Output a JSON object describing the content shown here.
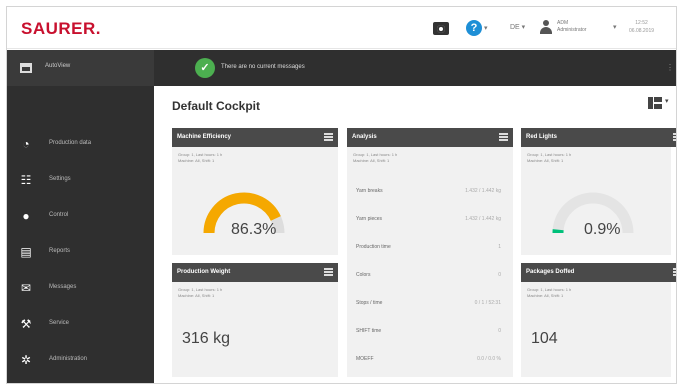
{
  "brand": {
    "logo": "SAURER.",
    "color": "#c8102e"
  },
  "topbar": {
    "camera_icon": "camera-icon",
    "help_icon_text": "?",
    "help_caret": "▾",
    "language": "DE ▾",
    "user_line1": "ADM",
    "user_line2": "Administrator",
    "user_caret": "▾",
    "time": "12:52",
    "date": "06.08.2019"
  },
  "sidebar": {
    "header_label": "AutoView",
    "items": [
      {
        "label": "Production data",
        "icon": "pie-chart-icon"
      },
      {
        "label": "Settings",
        "icon": "settings-icon"
      },
      {
        "label": "Control",
        "icon": "control-icon"
      },
      {
        "label": "Reports",
        "icon": "report-icon"
      },
      {
        "label": "Messages",
        "icon": "mail-icon"
      },
      {
        "label": "Service",
        "icon": "wrench-icon"
      },
      {
        "label": "Administration",
        "icon": "gear-icon"
      }
    ]
  },
  "notification": {
    "text": "There are no current messages",
    "check": "✓"
  },
  "main": {
    "title": "Default Cockpit",
    "layout_caret": "▾"
  },
  "cards": {
    "machine_efficiency": {
      "title": "Machine Efficiency",
      "meta1": "Group: 1, Last hours: 1 h",
      "meta2": "Machine: All, Shift: 1",
      "value": "86.3%",
      "gauge_fraction": 0.863,
      "gauge_color": "#f5a800"
    },
    "production_weight": {
      "title": "Production Weight",
      "meta1": "Group: 1, Last hours: 1 h",
      "meta2": "Machine: All, Shift: 1",
      "value": "316 kg"
    },
    "analysis": {
      "title": "Analysis",
      "meta1": "Group: 1, Last hours: 1 h",
      "meta2": "Machine: All, Shift: 1",
      "rows": [
        {
          "key": "Yarn breaks",
          "value": "1.432 / 1.442 kg"
        },
        {
          "key": "Yarn pieces",
          "value": "1.432 / 1.442 kg"
        },
        {
          "key": "Production time",
          "value": "1"
        },
        {
          "key": "Colors",
          "value": "0"
        },
        {
          "key": "Stops / time",
          "value": "0 / 1 / 52:31"
        },
        {
          "key": "SHIFT time",
          "value": "0"
        },
        {
          "key": "MOEFF",
          "value": "0.0 / 0.0 %"
        }
      ]
    },
    "red_lights": {
      "title": "Red Lights",
      "meta1": "Group: 1, Last hours: 1 h",
      "meta2": "Machine: All, Shift: 1",
      "value": "0.9%",
      "gauge_fraction": 0.009,
      "gauge_color": "#00c07a"
    },
    "packages_doffed": {
      "title": "Packages Doffed",
      "meta1": "Group: 1, Last hours: 1 h",
      "meta2": "Machine: All, Shift: 1",
      "value": "104"
    }
  }
}
